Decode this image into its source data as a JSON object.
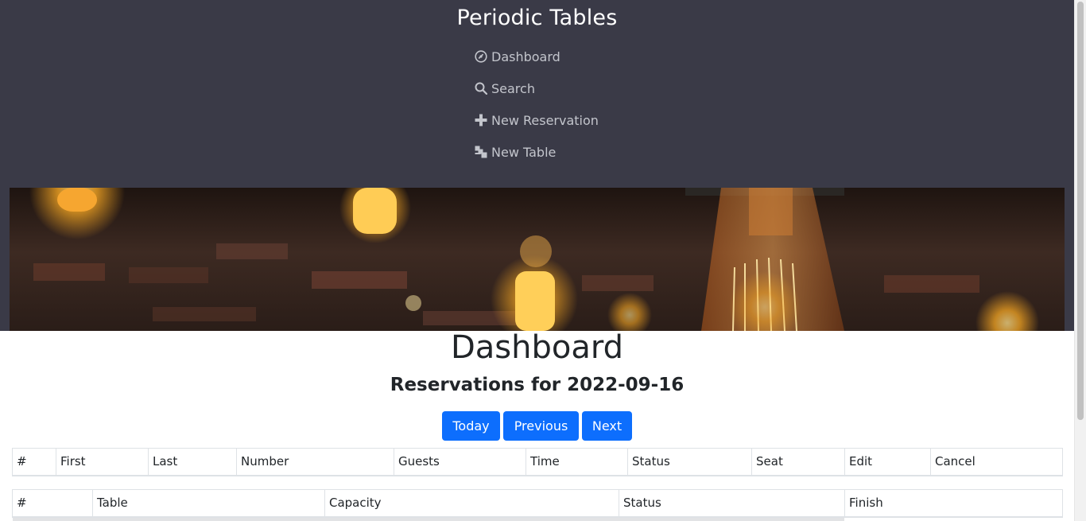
{
  "app": {
    "title": "Periodic Tables"
  },
  "nav": {
    "items": [
      {
        "label": "Dashboard",
        "icon": "dashboard-icon"
      },
      {
        "label": "Search",
        "icon": "search-icon"
      },
      {
        "label": "New Reservation",
        "icon": "plus-icon"
      },
      {
        "label": "New Table",
        "icon": "new-table-icon"
      }
    ]
  },
  "page": {
    "title": "Dashboard",
    "subtitle": "Reservations for 2022-09-16"
  },
  "buttons": {
    "today": "Today",
    "previous": "Previous",
    "next": "Next"
  },
  "reservations_table": {
    "headers": [
      "#",
      "First",
      "Last",
      "Number",
      "Guests",
      "Time",
      "Status",
      "Seat",
      "Edit",
      "Cancel"
    ],
    "rows": []
  },
  "tables_table": {
    "headers": [
      "#",
      "Table",
      "Capacity",
      "Status",
      "Finish"
    ],
    "rows": []
  },
  "colors": {
    "navbar": "#3a3a47",
    "primary": "#0d6efd",
    "nav_text": "#c3c5cc"
  }
}
